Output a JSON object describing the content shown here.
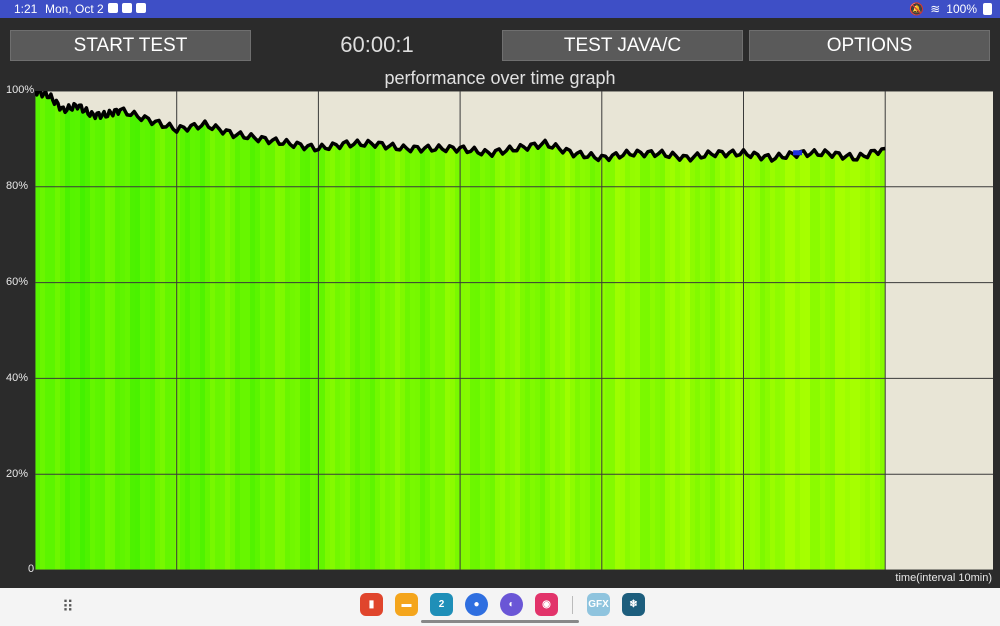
{
  "status_bar": {
    "time": "1:21",
    "date": "Mon, Oct 2",
    "battery": "100%"
  },
  "toolbar": {
    "start_label": "START TEST",
    "timer": "60:00:1",
    "java_label": "TEST JAVA/C",
    "options_label": "OPTIONS"
  },
  "chart_data": {
    "type": "line",
    "title": "performance over time graph",
    "xlabel": "time(interval 10min)",
    "y_tick_labels": [
      "100%",
      "80%",
      "60%",
      "40%",
      "20%",
      "0"
    ],
    "ylim": [
      0,
      100
    ],
    "x_interval_minutes": 10,
    "grid": true,
    "x_minutes": [
      0,
      1,
      2,
      3,
      4,
      5,
      6,
      8,
      10,
      12,
      14,
      16,
      18,
      20,
      22,
      24,
      26,
      28,
      30,
      32,
      34,
      36,
      38,
      40,
      42,
      44,
      46,
      48,
      50,
      52,
      54,
      56,
      58,
      60
    ],
    "values": [
      100,
      99,
      96,
      97,
      95,
      95,
      96,
      94,
      92,
      93,
      91,
      90,
      89,
      88,
      89,
      89,
      88,
      88,
      88,
      87,
      88,
      89,
      87,
      86,
      87,
      87,
      86,
      87,
      87,
      86,
      87,
      87,
      86,
      88
    ],
    "series_colors": {
      "line": "#000000",
      "fill_light": "#a6ff00",
      "fill_dark": "#3cf000",
      "background": "#e8e5d6"
    }
  },
  "dock": {
    "apps": [
      "slides-icon",
      "files-icon",
      "calendar-icon",
      "messages-icon",
      "browser-icon",
      "camera-icon"
    ],
    "recent": [
      "gfx-icon",
      "snowflake-icon"
    ],
    "calendar_day": "2",
    "gfx_label": "GFX"
  }
}
